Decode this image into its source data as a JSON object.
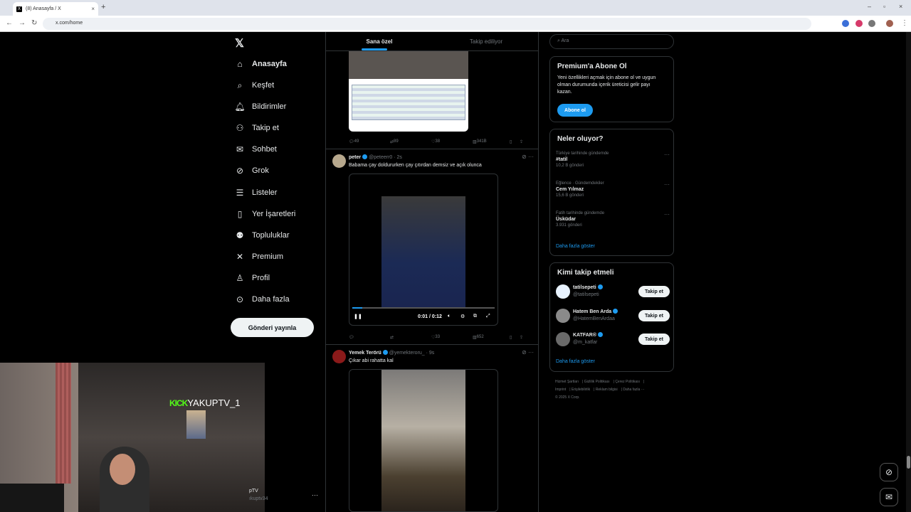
{
  "browser": {
    "tab_title": "(8) Anasayfa / X",
    "tab_close": "×",
    "new_tab": "+",
    "url": "x.com/home",
    "win_min": "–",
    "win_max": "▫",
    "win_close": "×"
  },
  "sidebar": {
    "logo": "𝕏",
    "items": [
      {
        "label": "Anasayfa",
        "icon": "home-icon"
      },
      {
        "label": "Keşfet",
        "icon": "search-icon"
      },
      {
        "label": "Bildirimler",
        "icon": "bell-icon"
      },
      {
        "label": "Takip et",
        "icon": "add-user-icon"
      },
      {
        "label": "Sohbet",
        "icon": "mail-icon"
      },
      {
        "label": "Grok",
        "icon": "grok-icon"
      },
      {
        "label": "Listeler",
        "icon": "list-icon"
      },
      {
        "label": "Yer İşaretleri",
        "icon": "bookmark-icon"
      },
      {
        "label": "Topluluklar",
        "icon": "people-icon"
      },
      {
        "label": "Premium",
        "icon": "x-icon"
      },
      {
        "label": "Profil",
        "icon": "person-icon"
      },
      {
        "label": "Daha fazla",
        "icon": "more-circle-icon"
      }
    ],
    "post_button": "Gönderi yayınla",
    "user_name": "pTV",
    "user_handle": "ıkuptv34",
    "user_more": "···"
  },
  "feed": {
    "tabs": [
      "Sana özel",
      "Takip ediliyor"
    ],
    "post0": {
      "replies": "49",
      "reposts": "89",
      "likes": "38",
      "views": "341B"
    },
    "post1": {
      "name": "peter",
      "handle": "@peteerr0 · 2s",
      "text": "Babama çay doldururken çay çıtırdan demsiz ve açık olunca",
      "time": "0:01 / 0:12",
      "replies": "",
      "reposts": "",
      "likes": "33",
      "views": "652"
    },
    "post2": {
      "name": "Yemek Terörü",
      "handle": "@yemekteroru_ · 9s",
      "text": "Çıkar abi rahatta kal"
    }
  },
  "right": {
    "search_placeholder": "Ara",
    "premium": {
      "title": "Premium'a Abone Ol",
      "desc": "Yeni özellikleri açmak için abone ol ve uygun olman durumunda içerik üreticisi gelir payı kazan.",
      "button": "Abone ol"
    },
    "trends_title": "Neler oluyor?",
    "trends": [
      {
        "context": "Türkiye tarihinde gündemde",
        "topic": "#tatil",
        "count": "10,2 B gönderi"
      },
      {
        "context": "Eğlence · Gündemdekiler",
        "topic": "Cem Yılmaz",
        "count": "15,6 B gönderi"
      },
      {
        "context": "Fatih tarihinde gündemde",
        "topic": "Üsküdar",
        "count": "3.931 gönderi"
      }
    ],
    "trends_more": "Daha fazla göster",
    "who_title": "Kimi takip etmeli",
    "who": [
      {
        "name": "tatilsepeti",
        "handle": "@tatilsepeti",
        "btn": "Takip et"
      },
      {
        "name": "Hatem Ben Arda",
        "handle": "@HatemBenArdaa",
        "btn": "Takip et"
      },
      {
        "name": "KATFAR®",
        "handle": "@m_katfar",
        "btn": "Takip et"
      }
    ],
    "who_more": "Daha fazla göster",
    "footer": [
      "Hizmet Şartları",
      "Gizlilik Politikası",
      "Çerez Politikası",
      "Imprint",
      "Erişilebilirlik",
      "Reklam bilgisi",
      "Daha fazla ···",
      "© 2025 X Corp."
    ]
  },
  "overlay": {
    "kick_logo": "KICK",
    "kick_user": "YAKUPTV_1"
  },
  "colors": {
    "accent": "#1d9bf0",
    "kick": "#53fc18"
  }
}
